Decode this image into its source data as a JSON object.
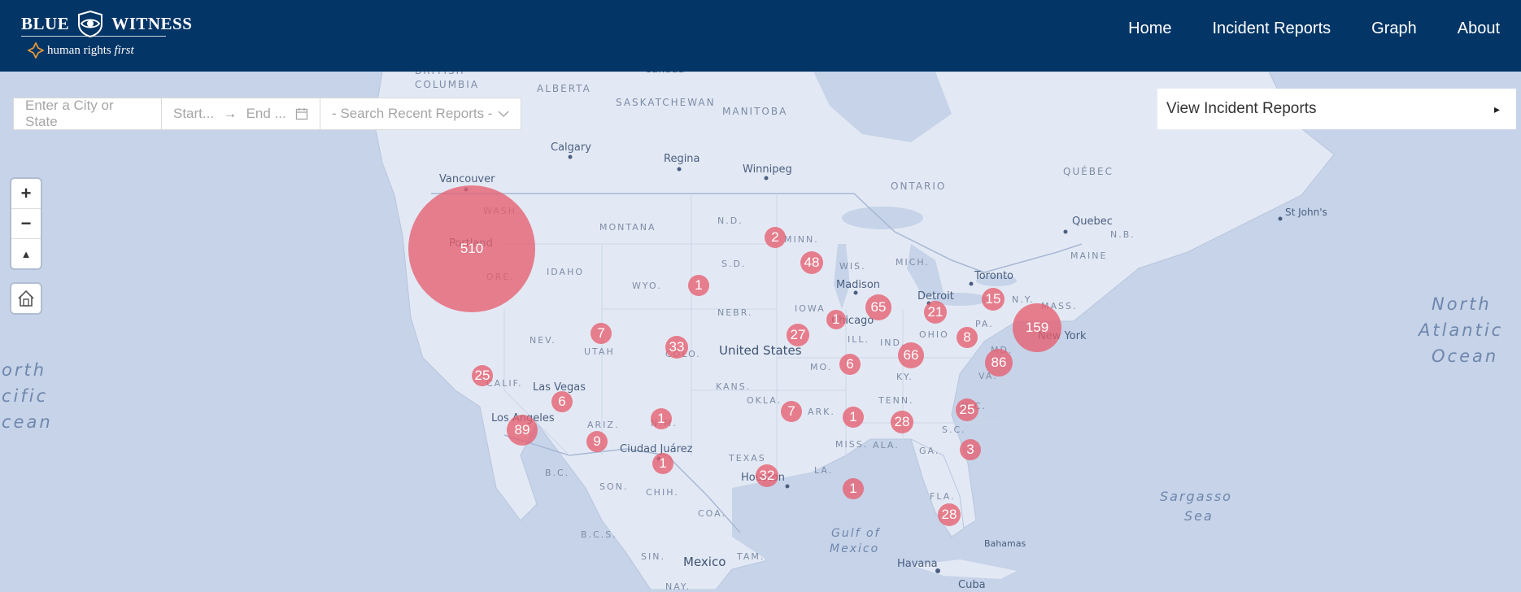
{
  "brand": {
    "word_left": "BLUE",
    "word_right": "WITNESS",
    "subtitle_plain": "human rights ",
    "subtitle_italic": "first"
  },
  "nav": {
    "items": [
      {
        "label": "Home"
      },
      {
        "label": "Incident Reports"
      },
      {
        "label": "Graph"
      },
      {
        "label": "About"
      }
    ]
  },
  "filters": {
    "city_placeholder": "Enter a City or State",
    "start_placeholder": "Start...",
    "arrow": "→",
    "end_placeholder": "End ...",
    "recent_placeholder": "- Search Recent Reports -"
  },
  "zoom": {
    "in": "+",
    "out": "−",
    "reset": "▲"
  },
  "panel": {
    "label": "View Incident Reports",
    "caret": "▸"
  },
  "map_labels": [
    {
      "text": "BRITISH"
    },
    {
      "text": "COLUMBIA"
    },
    {
      "text": "ALBERTA"
    },
    {
      "text": "SASKATCHEWAN"
    },
    {
      "text": "MANITOBA"
    },
    {
      "text": "ONTARIO"
    },
    {
      "text": "QUÉBEC"
    },
    {
      "text": "Calgary"
    },
    {
      "text": "Regina"
    },
    {
      "text": "Winnipeg"
    },
    {
      "text": "Vancouver"
    },
    {
      "text": "WASH."
    },
    {
      "text": "MONTANA"
    },
    {
      "text": "N.D."
    },
    {
      "text": "MINN."
    },
    {
      "text": "Portland"
    },
    {
      "text": "IDAHO"
    },
    {
      "text": "ORE."
    },
    {
      "text": "WYO."
    },
    {
      "text": "S.D."
    },
    {
      "text": "WIS."
    },
    {
      "text": "MICH."
    },
    {
      "text": "Madison"
    },
    {
      "text": "Detroit"
    },
    {
      "text": "Toronto"
    },
    {
      "text": "Quebec"
    },
    {
      "text": "N.B."
    },
    {
      "text": "MAINE"
    },
    {
      "text": "St John's"
    },
    {
      "text": "NEBR."
    },
    {
      "text": "IOWA"
    },
    {
      "text": "Chicago"
    },
    {
      "text": "OHIO"
    },
    {
      "text": "PA."
    },
    {
      "text": "N.Y."
    },
    {
      "text": "MASS."
    },
    {
      "text": "New York"
    },
    {
      "text": "NEV."
    },
    {
      "text": "UTAH"
    },
    {
      "text": "COLO."
    },
    {
      "text": "United States"
    },
    {
      "text": "ILL."
    },
    {
      "text": "IND."
    },
    {
      "text": "MD."
    },
    {
      "text": "KY."
    },
    {
      "text": "VA."
    },
    {
      "text": "MO."
    },
    {
      "text": "CALIF."
    },
    {
      "text": "Las Vegas"
    },
    {
      "text": "KANS."
    },
    {
      "text": "OKLA."
    },
    {
      "text": "ARK."
    },
    {
      "text": "TENN."
    },
    {
      "text": "N.C."
    },
    {
      "text": "S.C."
    },
    {
      "text": "Los Angeles"
    },
    {
      "text": "ARIZ."
    },
    {
      "text": "N.M."
    },
    {
      "text": "MISS."
    },
    {
      "text": "ALA."
    },
    {
      "text": "GA."
    },
    {
      "text": "TEXAS"
    },
    {
      "text": "Ciudad Juárez"
    },
    {
      "text": "LA."
    },
    {
      "text": "Houston"
    },
    {
      "text": "B.C."
    },
    {
      "text": "SON."
    },
    {
      "text": "CHIH."
    },
    {
      "text": "COA."
    },
    {
      "text": "FLA."
    },
    {
      "text": "B.C.S."
    },
    {
      "text": "SIN."
    },
    {
      "text": "TAM."
    },
    {
      "text": "Mexico"
    },
    {
      "text": "Havana"
    },
    {
      "text": "Bahamas"
    },
    {
      "text": "Cuba"
    },
    {
      "text": "NAY."
    },
    {
      "text": "Canada"
    }
  ],
  "water_labels": [
    {
      "text": "North"
    },
    {
      "text": "Atlantic"
    },
    {
      "text": "Ocean"
    },
    {
      "text": "orth"
    },
    {
      "text": "cific"
    },
    {
      "text": "cean"
    },
    {
      "text": "Gulf of"
    },
    {
      "text": "Mexico"
    },
    {
      "text": "Sargasso"
    },
    {
      "text": "Sea"
    }
  ],
  "clusters": [
    {
      "count": "510"
    },
    {
      "count": "2"
    },
    {
      "count": "48"
    },
    {
      "count": "1"
    },
    {
      "count": "65"
    },
    {
      "count": "21"
    },
    {
      "count": "15"
    },
    {
      "count": "159"
    },
    {
      "count": "1"
    },
    {
      "count": "27"
    },
    {
      "count": "7"
    },
    {
      "count": "33"
    },
    {
      "count": "66"
    },
    {
      "count": "8"
    },
    {
      "count": "86"
    },
    {
      "count": "6"
    },
    {
      "count": "25"
    },
    {
      "count": "6"
    },
    {
      "count": "89"
    },
    {
      "count": "9"
    },
    {
      "count": "1"
    },
    {
      "count": "7"
    },
    {
      "count": "1"
    },
    {
      "count": "28"
    },
    {
      "count": "25"
    },
    {
      "count": "3"
    },
    {
      "count": "1"
    },
    {
      "count": "32"
    },
    {
      "count": "1"
    },
    {
      "count": "28"
    }
  ],
  "colors": {
    "header": "#033566",
    "water": "#c6d3e8",
    "land": "#e3e9f4",
    "cluster": "#e65f70"
  }
}
